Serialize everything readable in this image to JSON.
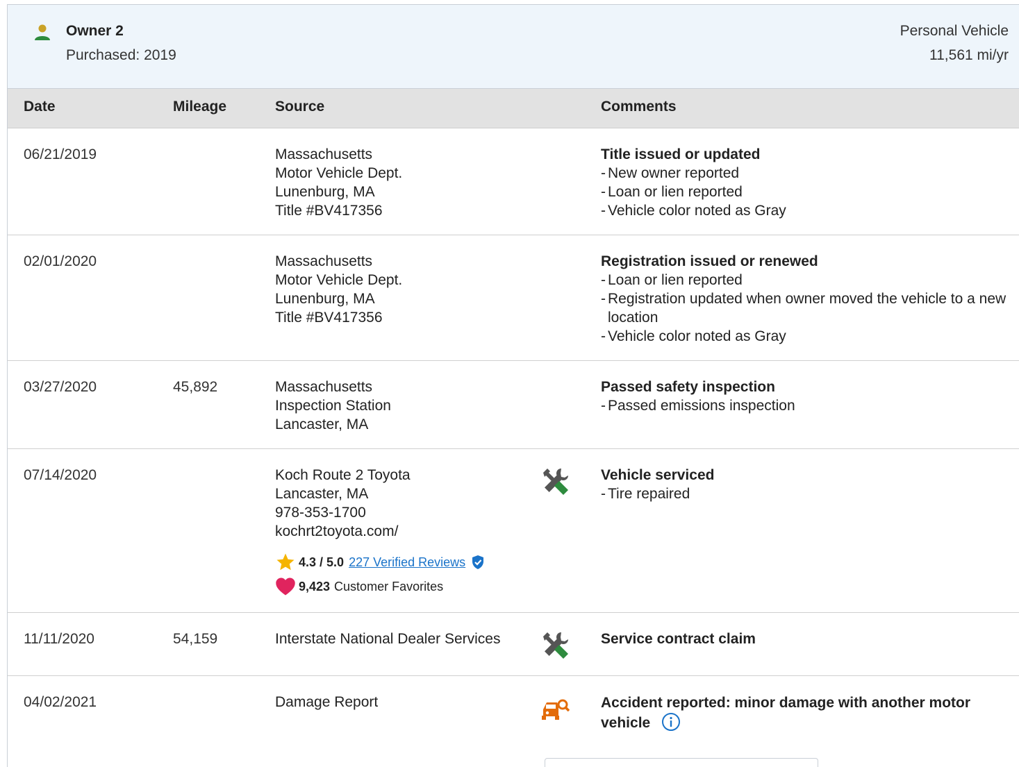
{
  "owner": {
    "name": "Owner 2",
    "purchased": "Purchased: 2019",
    "vehicle_type": "Personal Vehicle",
    "miles_per_year": "11,561 mi/yr",
    "icon": "person-icon"
  },
  "table": {
    "headers": {
      "date": "Date",
      "mileage": "Mileage",
      "source": "Source",
      "comments": "Comments"
    },
    "rows": [
      {
        "date": "06/21/2019",
        "mileage": "",
        "source": [
          "Massachusetts",
          "Motor Vehicle Dept.",
          "Lunenburg, MA",
          "Title #BV417356"
        ],
        "comment_title": "Title issued or updated",
        "comments": [
          "New owner reported",
          "Loan or lien reported",
          "Vehicle color noted as Gray"
        ]
      },
      {
        "date": "02/01/2020",
        "mileage": "",
        "source": [
          "Massachusetts",
          "Motor Vehicle Dept.",
          "Lunenburg, MA",
          "Title #BV417356"
        ],
        "comment_title": "Registration issued or renewed",
        "comments": [
          "Loan or lien reported",
          "Registration updated when owner moved the vehicle to a new location",
          "Vehicle color noted as Gray"
        ]
      },
      {
        "date": "03/27/2020",
        "mileage": "45,892",
        "source": [
          "Massachusetts",
          "Inspection Station",
          "Lancaster, MA"
        ],
        "comment_title": "Passed safety inspection",
        "comments": [
          "Passed emissions inspection"
        ]
      },
      {
        "date": "07/14/2020",
        "mileage": "",
        "source": [
          "Koch Route 2 Toyota",
          "Lancaster, MA",
          "978-353-1700",
          "kochrt2toyota.com/"
        ],
        "icon": "service-tools-icon",
        "rating": {
          "score": "4.3 / 5.0",
          "reviews_link": "227 Verified Reviews",
          "favorites_count": "9,423",
          "favorites_label": "Customer Favorites"
        },
        "comment_title": "Vehicle serviced",
        "comments": [
          "Tire repaired"
        ]
      },
      {
        "date": "11/11/2020",
        "mileage": "54,159",
        "source": [
          "Interstate National Dealer Services"
        ],
        "icon": "service-tools-icon",
        "comment_title": "Service contract claim",
        "comments": []
      },
      {
        "date": "04/02/2021",
        "mileage": "",
        "source": [
          "Damage Report"
        ],
        "icon": "damage-report-icon",
        "comment_title": "Accident reported: minor damage with another motor vehicle",
        "comments": []
      }
    ]
  },
  "colors": {
    "header_bg": "#eef5fb",
    "table_header_bg": "#e2e2e2",
    "service_icon_green": "#2e8b3e",
    "service_icon_grey": "#555555",
    "damage_icon_orange": "#e36c0a",
    "link_blue": "#1a73c9",
    "star_gold": "#f5b400",
    "heart_pink": "#e0245e"
  }
}
